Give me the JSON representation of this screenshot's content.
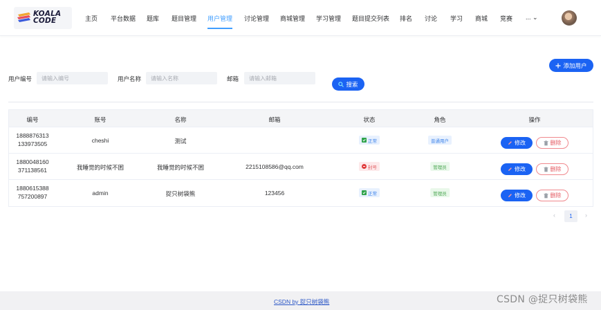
{
  "logo": {
    "line1": "KOALA",
    "line2": "CODE"
  },
  "nav": [
    {
      "label": "主页",
      "name": "nav-home"
    },
    {
      "label": "平台数据",
      "name": "nav-platform-data"
    },
    {
      "label": "题库",
      "name": "nav-problem-bank"
    },
    {
      "label": "题目管理",
      "name": "nav-problem-manage"
    },
    {
      "label": "用户管理",
      "name": "nav-user-manage",
      "active": true
    },
    {
      "label": "讨论管理",
      "name": "nav-discussion-manage"
    },
    {
      "label": "商城管理",
      "name": "nav-shop-manage"
    },
    {
      "label": "学习管理",
      "name": "nav-study-manage"
    },
    {
      "label": "题目提交列表",
      "name": "nav-submission-list"
    },
    {
      "label": "排名",
      "name": "nav-ranking"
    },
    {
      "label": "讨论",
      "name": "nav-discussion"
    },
    {
      "label": "学习",
      "name": "nav-study"
    },
    {
      "label": "商城",
      "name": "nav-shop"
    },
    {
      "label": "竞赛",
      "name": "nav-contest"
    },
    {
      "label": "... ⌄",
      "name": "nav-more"
    }
  ],
  "toolbar": {
    "add_user_label": "添加用户",
    "search_label": "搜索"
  },
  "search": {
    "user_id_label": "用户编号",
    "user_id_placeholder": "请输入编号",
    "username_label": "用户名称",
    "username_placeholder": "请输入名称",
    "email_label": "邮箱",
    "email_placeholder": "请输入邮箱"
  },
  "table": {
    "headers": [
      "编号",
      "账号",
      "名称",
      "邮箱",
      "状态",
      "角色",
      "操作"
    ],
    "rows": [
      {
        "id_line1": "1888876313",
        "id_line2": "133973505",
        "account": "cheshi",
        "name": "测试",
        "email": "",
        "status": "正常",
        "status_type": "normal",
        "role": "普通用户",
        "role_type": "user"
      },
      {
        "id_line1": "1880048160",
        "id_line2": "371138561",
        "account": "我睡觉的时候不困",
        "name": "我睡觉的时候不困",
        "email": "2215108586@qq.com",
        "status": "封号",
        "status_type": "banned",
        "role": "管理员",
        "role_type": "admin"
      },
      {
        "id_line1": "1880615388",
        "id_line2": "757200897",
        "account": "admin",
        "name": "捉只树袋熊",
        "email": "123456",
        "status": "正常",
        "status_type": "normal",
        "role": "管理员",
        "role_type": "admin"
      }
    ],
    "edit_label": "修改",
    "delete_label": "删除"
  },
  "pagination": {
    "prev": "‹",
    "current": "1",
    "next": "›"
  },
  "footer": {
    "link_text": "CSDN by 捉只树袋熊"
  },
  "watermark": "CSDN @捉只树袋熊",
  "colors": {
    "primary": "#1b63f3",
    "accent": "#409eff",
    "danger": "#e45a62",
    "success": "#2fa34a"
  }
}
